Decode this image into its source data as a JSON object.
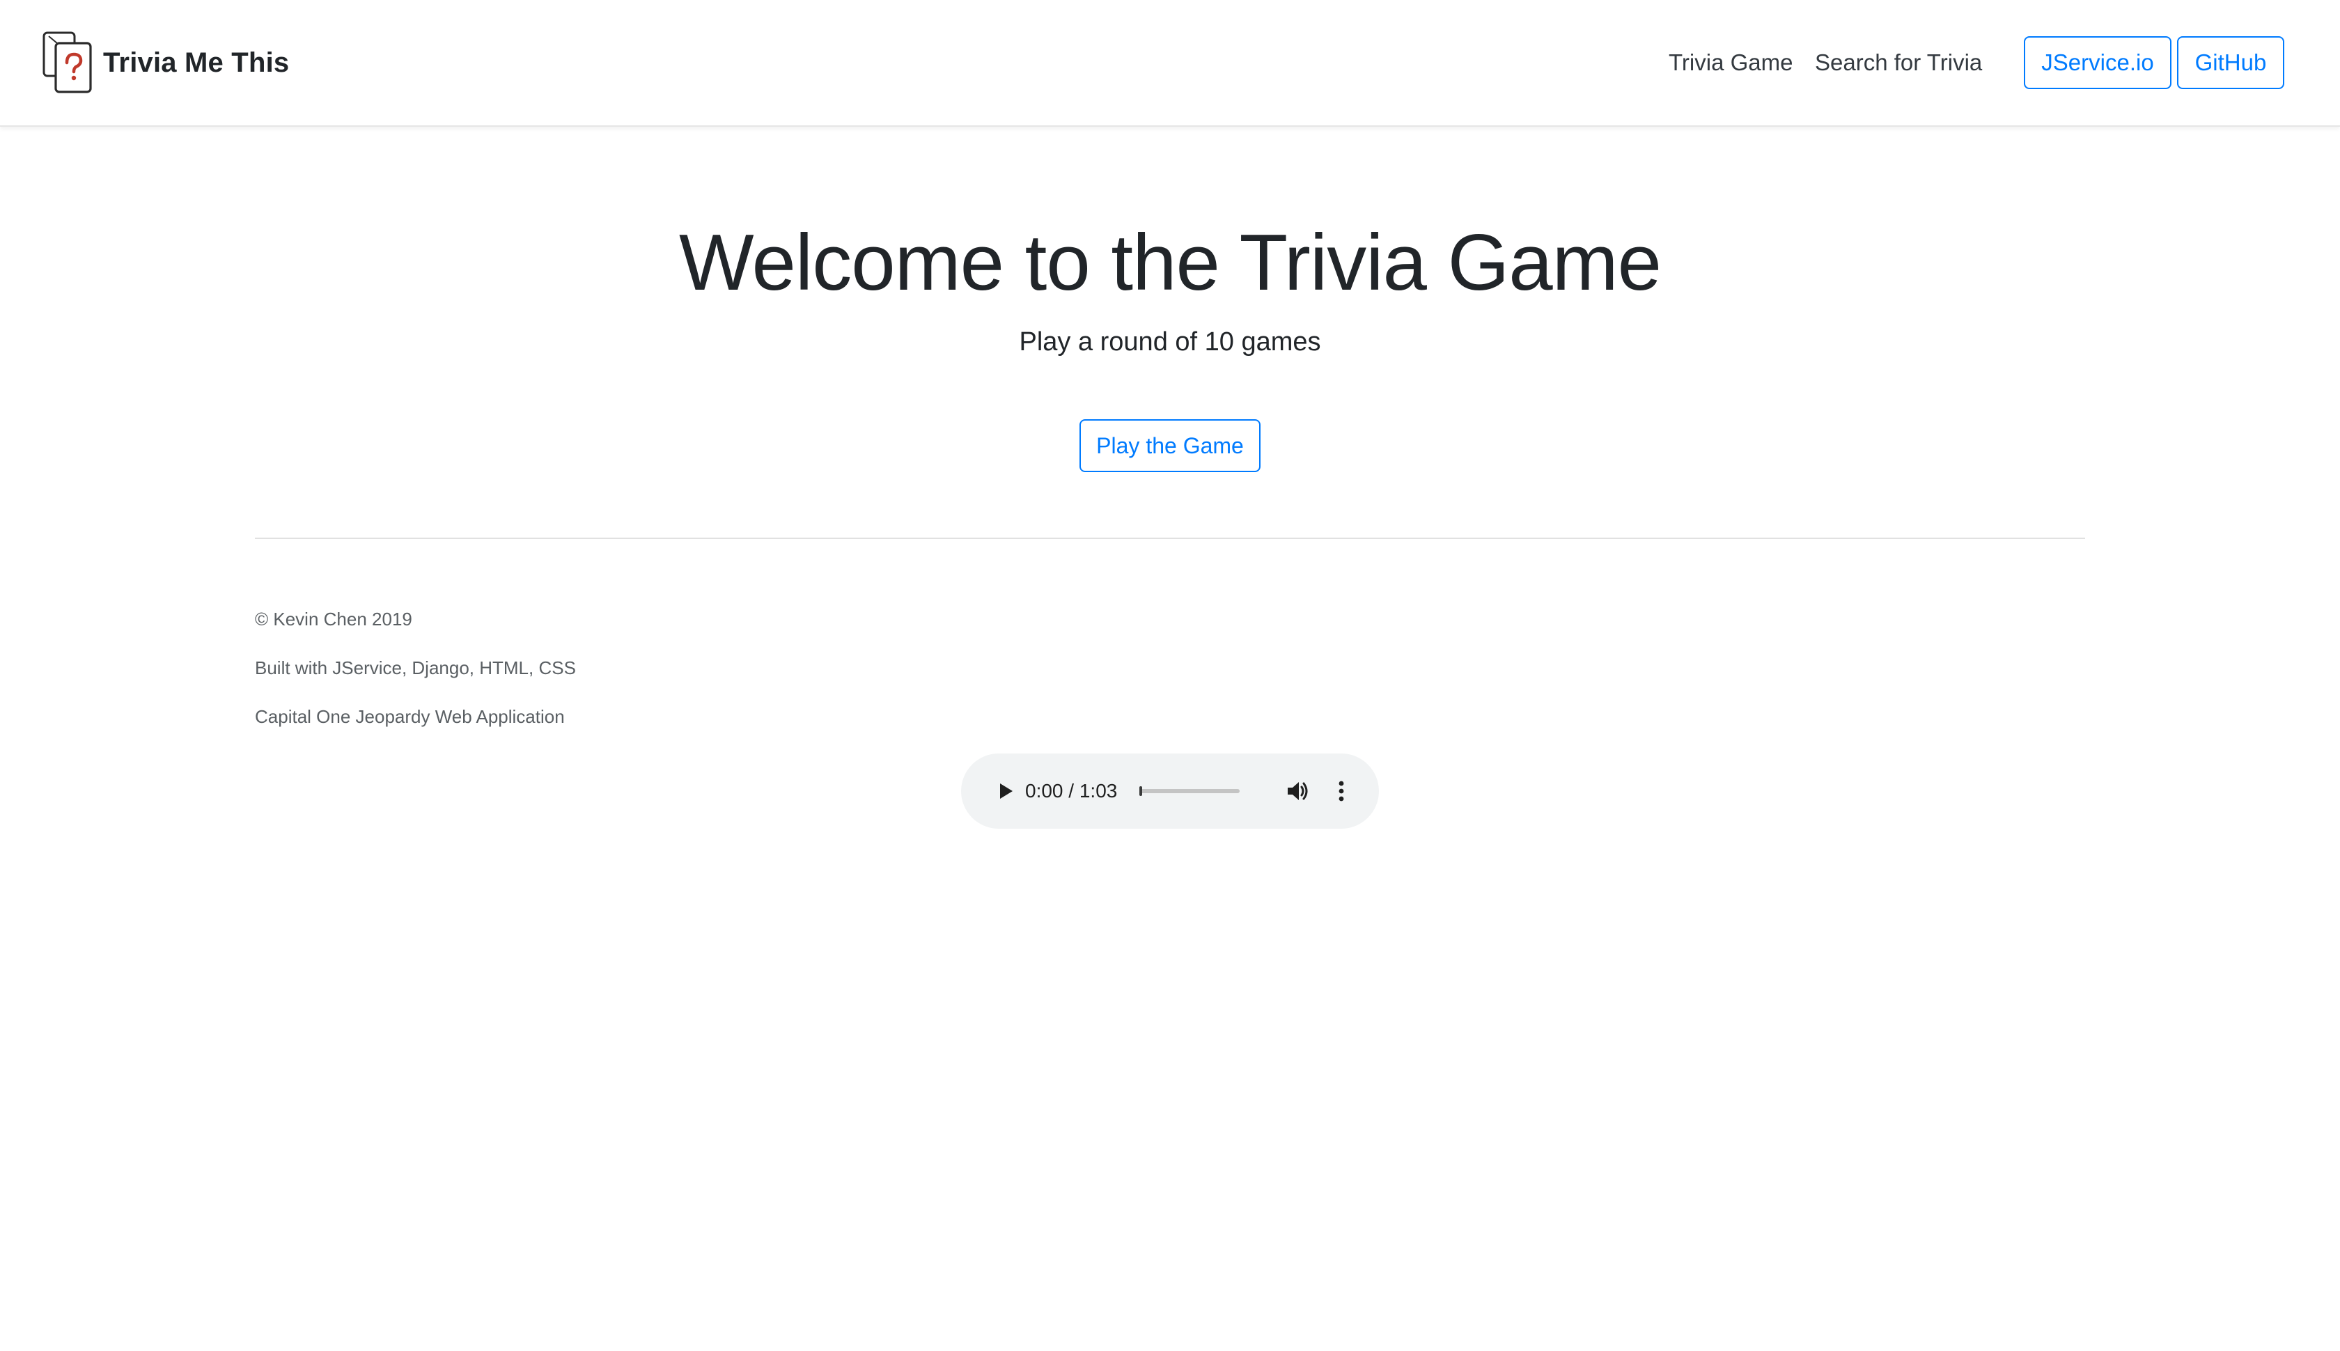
{
  "brand": {
    "name": "Trivia Me This",
    "logo_icon": "trivia-cards-question-icon"
  },
  "nav": {
    "links": [
      {
        "label": "Trivia Game"
      },
      {
        "label": "Search for Trivia"
      }
    ],
    "buttons": [
      {
        "label": "JService.io"
      },
      {
        "label": "GitHub"
      }
    ]
  },
  "hero": {
    "title": "Welcome to the Trivia Game",
    "subtitle": "Play a round of 10 games",
    "play_label": "Play the Game"
  },
  "footer": {
    "lines": [
      "© Kevin Chen 2019",
      "Built with JService, Django, HTML, CSS",
      "Capital One Jeopardy Web Application"
    ]
  },
  "audio": {
    "current_time": "0:00",
    "separator": " / ",
    "duration": "1:03",
    "progress_fraction": 0.0,
    "icons": [
      "play-icon",
      "volume-icon",
      "more-vertical-icon"
    ]
  },
  "colors": {
    "primary": "#007bff",
    "text": "#212529",
    "muted": "#5a5f63",
    "audio_bg": "#f1f3f4",
    "logo_accent": "#c0392b"
  }
}
